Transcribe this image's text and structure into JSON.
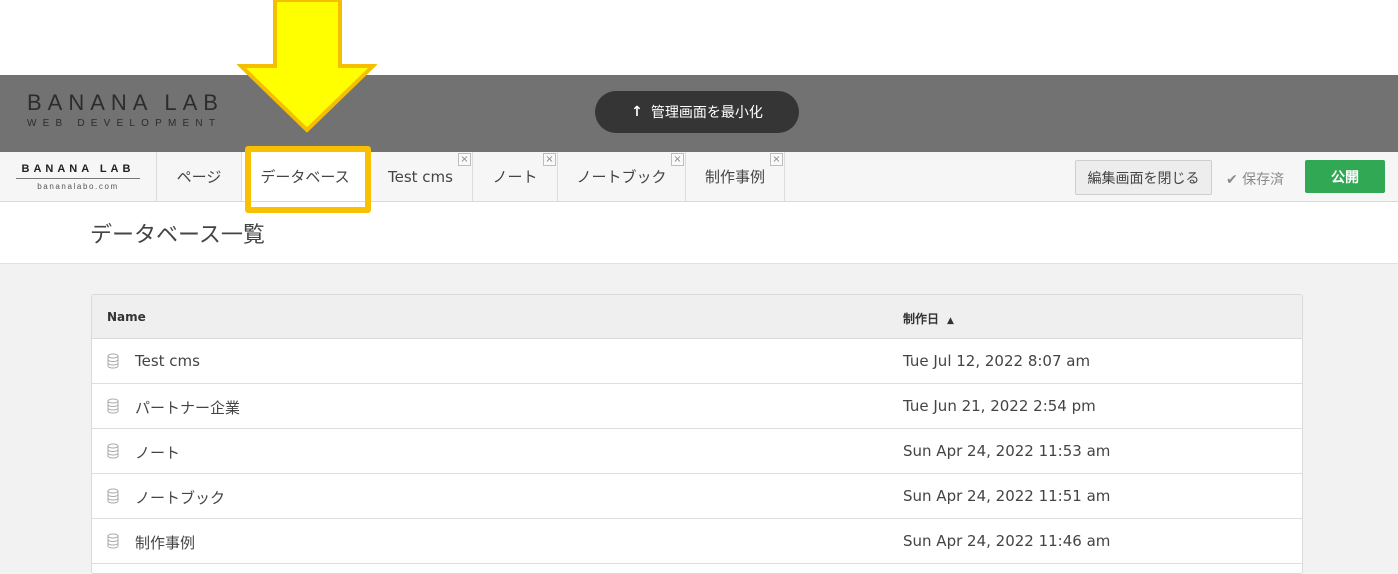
{
  "admin_bar": {
    "logo_name": "BANANA LAB",
    "logo_sub": "WEB DEVELOPMENT",
    "minimize_label": "管理画面を最小化"
  },
  "tab_bar": {
    "logo_name": "BANANA LAB",
    "logo_url": "bananalabo.com",
    "tabs": [
      {
        "label": "ページ",
        "closable": false
      },
      {
        "label": "データベース",
        "closable": false,
        "active": true
      },
      {
        "label": "Test cms",
        "closable": true
      },
      {
        "label": "ノート",
        "closable": true
      },
      {
        "label": "ノートブック",
        "closable": true
      },
      {
        "label": "制作事例",
        "closable": true
      }
    ],
    "close_icon": "×",
    "close_edit_label": "編集画面を閉じる",
    "saved_label": "✔ 保存済",
    "publish_label": "公開"
  },
  "page": {
    "title": "データベース一覧"
  },
  "table": {
    "columns": {
      "name": "Name",
      "date": "制作日",
      "sort_icon": "▲"
    },
    "rows": [
      {
        "name": "Test cms",
        "date": "Tue Jul 12, 2022 8:07 am"
      },
      {
        "name": "パートナー企業",
        "date": "Tue Jun 21, 2022 2:54 pm"
      },
      {
        "name": "ノート",
        "date": "Sun Apr 24, 2022 11:53 am"
      },
      {
        "name": "ノートブック",
        "date": "Sun Apr 24, 2022 11:51 am"
      },
      {
        "name": "制作事例",
        "date": "Sun Apr 24, 2022 11:46 am"
      }
    ]
  },
  "colors": {
    "admin_bar": "#727272",
    "publish": "#31a853",
    "highlight": "#f8c000",
    "arrow_fill": "#ffff00"
  }
}
